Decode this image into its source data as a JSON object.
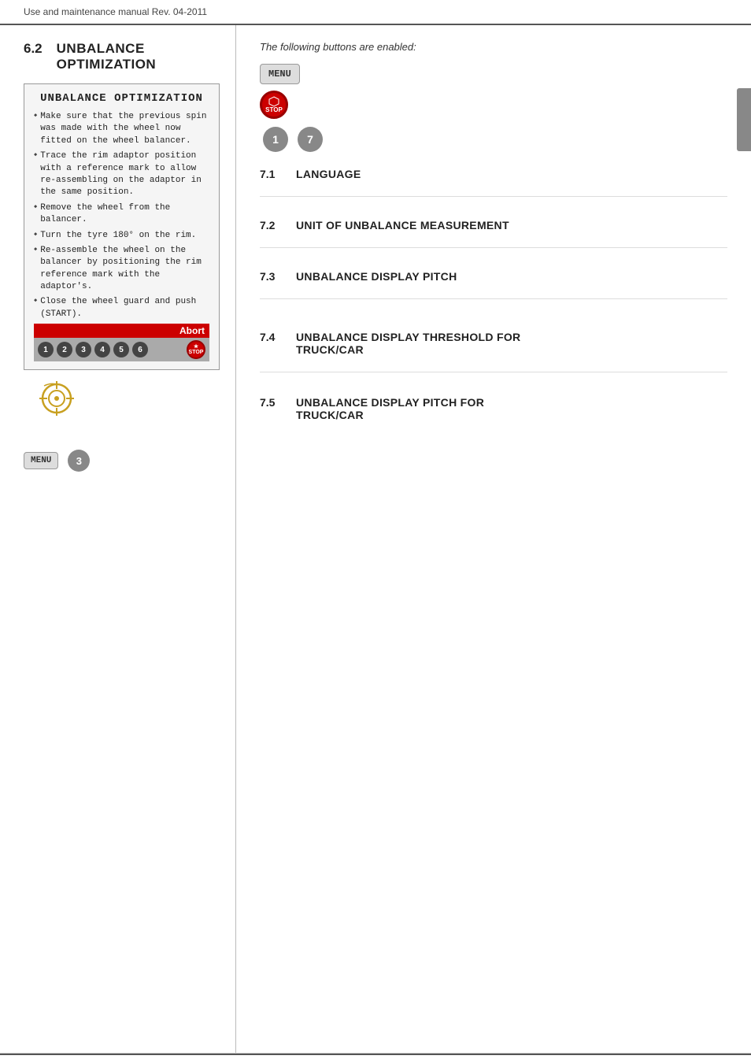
{
  "header": {
    "text": "Use and maintenance manual Rev. 04-2011"
  },
  "left": {
    "section_num": "6.2",
    "section_title": "UNBALANCE OPTIMIZATION",
    "screen": {
      "title": "UNBALANCE OPTIMIZATION",
      "bullets": [
        "Make sure that the previous spin was made with the wheel now fitted on the wheel balancer.",
        "Trace the rim adaptor position with a reference mark to allow re-assembling on the adaptor in the same position.",
        "Remove the wheel from the balancer.",
        "Turn the tyre 180° on the rim.",
        "Re-assemble the wheel on the balancer by positioning the rim reference mark with the adaptor's.",
        "Close the wheel guard and push (START)."
      ]
    },
    "abort_label": "Abort",
    "number_strip": [
      "1",
      "2",
      "3",
      "4",
      "5",
      "6"
    ],
    "menu_label": "MENU",
    "menu_num": "3"
  },
  "right": {
    "intro": "The following buttons are enabled:",
    "menu_label": "MENU",
    "stop_label": "STOP",
    "circle_buttons": [
      "1",
      "7"
    ],
    "sections": [
      {
        "num": "7.1",
        "title": "LANGUAGE"
      },
      {
        "num": "7.2",
        "title": "UNIT OF UNBALANCE MEASUREMENT"
      },
      {
        "num": "7.3",
        "title": "UNBALANCE DISPLAY PITCH"
      },
      {
        "num": "7.4",
        "title": "UNBALANCE DISPLAY THRESHOLD FOR TRUCK/CAR"
      },
      {
        "num": "7.5",
        "title": "UNBALANCE DISPLAY PITCH FOR TRUCK/CAR"
      }
    ]
  }
}
